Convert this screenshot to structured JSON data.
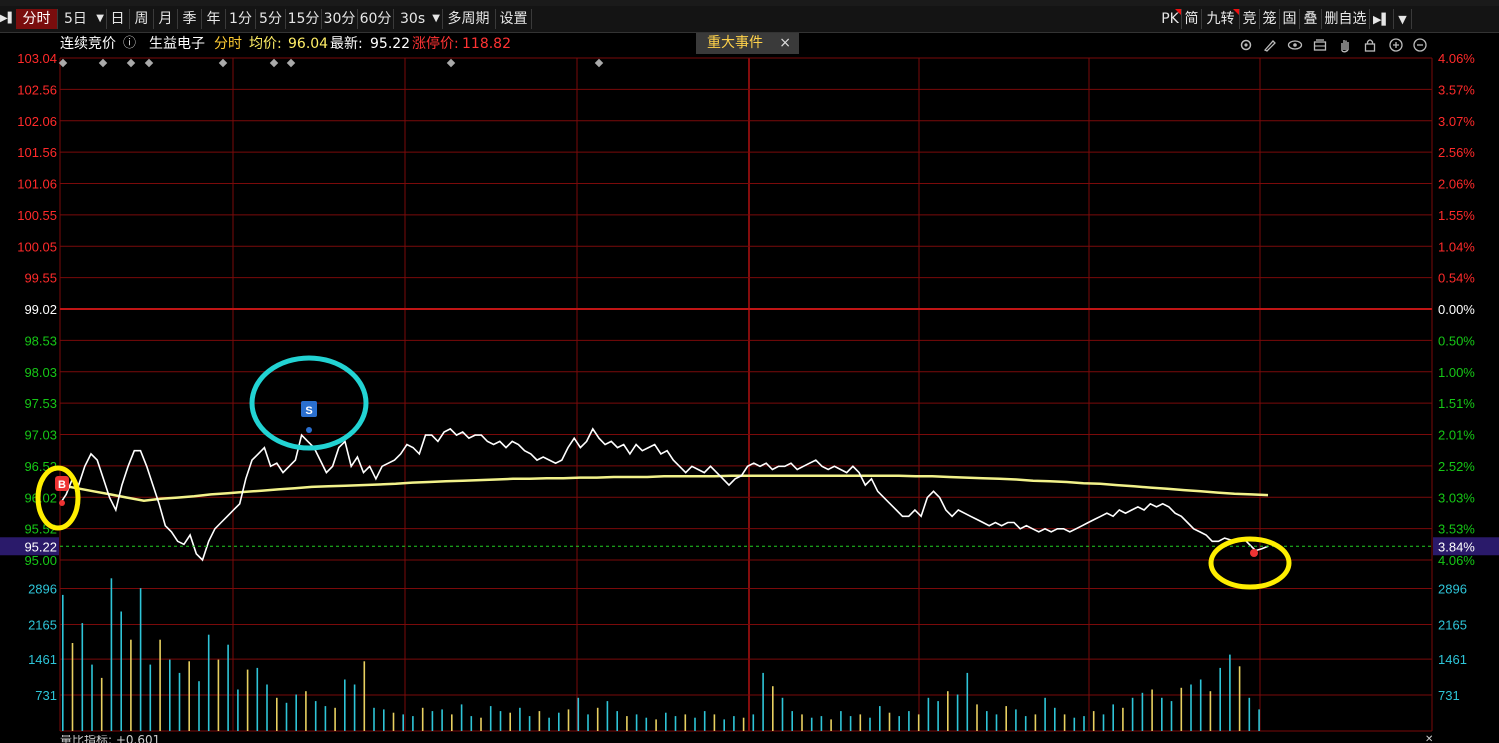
{
  "toolbar": {
    "play_glyph": "▶▌",
    "tabs": [
      {
        "label": "分时",
        "active": true
      },
      {
        "label": "5日",
        "dropdown": true
      },
      {
        "label": "日"
      },
      {
        "label": "周"
      },
      {
        "label": "月"
      },
      {
        "label": "季"
      },
      {
        "label": "年"
      },
      {
        "label": "1分"
      },
      {
        "label": "5分"
      },
      {
        "label": "15分"
      },
      {
        "label": "30分"
      },
      {
        "label": "60分"
      },
      {
        "label": "30s",
        "dropdown": true
      },
      {
        "label": "多周期"
      },
      {
        "label": "设置"
      }
    ],
    "right_buttons": [
      {
        "label": "PK",
        "flag": true
      },
      {
        "label": "简"
      },
      {
        "label": "九转",
        "flag": true
      },
      {
        "label": "竞"
      },
      {
        "label": "笼"
      },
      {
        "label": "固"
      },
      {
        "label": "叠"
      },
      {
        "label": "删自选"
      },
      {
        "label": "▶▌"
      },
      {
        "label": "▼"
      }
    ]
  },
  "infobar": {
    "mode_label": "连续竞价",
    "info_icon": "ⓘ",
    "stock_name": "生益电子",
    "chart_type": "分时",
    "avg_label": "均价:",
    "avg_value": "96.04",
    "latest_label": "最新:",
    "latest_value": "95.22",
    "limit_label": "涨停价:",
    "limit_value": "118.82"
  },
  "event_tab": {
    "label": "重大事件",
    "close": "×"
  },
  "tool_icons": [
    "gear-icon",
    "pen-icon",
    "eye-icon",
    "layers-icon",
    "hand-icon",
    "lock-icon",
    "zoom-in-icon",
    "zoom-out-icon"
  ],
  "markers": {
    "buy": "B",
    "sell": "S"
  },
  "colors": {
    "up": "#ff2a2a",
    "down": "#16c716",
    "grid": "#7a0a0a",
    "price_line": "#ffffff",
    "avg_line": "#f2f28a",
    "vol_up": "#e8d060",
    "vol_down": "#2ec5d8",
    "current": "#2a1a6a",
    "circle_cyan": "#22d3d3",
    "circle_yellow": "#ffee00"
  },
  "bottom_indicator": "量比指标: +0.601",
  "chart_data": {
    "type": "line",
    "prev_close": 99.02,
    "price_axis": {
      "labels": [
        "103.04",
        "102.56",
        "102.06",
        "101.56",
        "101.06",
        "100.55",
        "100.05",
        "99.55",
        "99.02",
        "98.53",
        "98.03",
        "97.53",
        "97.03",
        "96.52",
        "96.02",
        "95.52",
        "95.00"
      ],
      "current": "95.22",
      "ylim": [
        95.0,
        103.04
      ]
    },
    "pct_axis": {
      "labels": [
        "4.06%",
        "3.57%",
        "3.07%",
        "2.56%",
        "2.06%",
        "1.55%",
        "1.04%",
        "0.54%",
        "0.00%",
        "0.50%",
        "1.00%",
        "1.51%",
        "2.01%",
        "2.52%",
        "3.03%",
        "3.53%",
        "4.06%"
      ],
      "current": "3.84%"
    },
    "volume_axis": {
      "labels": [
        "2896",
        "2165",
        "1461",
        "731"
      ],
      "values": [
        2896,
        2165,
        1461,
        731
      ]
    },
    "series": [
      {
        "key": "price",
        "values": [
          95.9,
          96.05,
          96.3,
          96.2,
          96.5,
          96.7,
          96.6,
          96.3,
          96.0,
          95.8,
          96.2,
          96.5,
          96.75,
          96.75,
          96.5,
          96.2,
          95.9,
          95.55,
          95.45,
          95.3,
          95.25,
          95.4,
          95.1,
          95.0,
          95.3,
          95.5,
          95.6,
          95.7,
          95.8,
          95.9,
          96.3,
          96.6,
          96.7,
          96.8,
          96.5,
          96.55,
          96.4,
          96.5,
          96.6,
          97.0,
          96.9,
          96.8,
          96.6,
          96.4,
          96.5,
          96.8,
          96.9,
          96.5,
          96.65,
          96.4,
          96.5,
          96.3,
          96.5,
          96.55,
          96.6,
          96.7,
          96.85,
          96.8,
          96.7,
          97.0,
          97.0,
          96.9,
          97.05,
          97.1,
          97.0,
          97.05,
          96.95,
          97.0,
          97.0,
          96.9,
          96.85,
          96.9,
          96.8,
          96.9,
          96.85,
          96.75,
          96.7,
          96.6,
          96.65,
          96.6,
          96.55,
          96.6,
          96.8,
          96.95,
          96.8,
          96.9,
          97.1,
          96.95,
          96.85,
          96.9,
          96.8,
          96.85,
          96.7,
          96.85,
          96.75,
          96.8,
          96.85,
          96.7,
          96.75,
          96.6,
          96.5,
          96.4,
          96.5,
          96.45,
          96.4,
          96.5,
          96.4,
          96.3,
          96.2,
          96.3,
          96.35,
          96.5,
          96.55,
          96.5,
          96.55,
          96.45,
          96.5,
          96.5,
          96.55,
          96.45,
          96.5,
          96.55,
          96.6,
          96.5,
          96.45,
          96.5,
          96.45,
          96.4,
          96.5,
          96.4,
          96.2,
          96.3,
          96.1,
          96.0,
          95.9,
          95.8,
          95.7,
          95.7,
          95.8,
          95.7,
          96.0,
          96.1,
          96.0,
          95.8,
          95.7,
          95.8,
          95.75,
          95.7,
          95.65,
          95.6,
          95.55,
          95.6,
          95.55,
          95.6,
          95.6,
          95.5,
          95.55,
          95.5,
          95.45,
          95.5,
          95.45,
          95.5,
          95.5,
          95.45,
          95.5,
          95.55,
          95.6,
          95.65,
          95.7,
          95.75,
          95.7,
          95.8,
          95.75,
          95.8,
          95.85,
          95.8,
          95.9,
          95.85,
          95.9,
          95.85,
          95.75,
          95.7,
          95.6,
          95.5,
          95.45,
          95.4,
          95.3,
          95.3,
          95.35,
          95.32,
          95.3,
          95.35,
          95.25,
          95.15,
          95.18,
          95.22
        ],
        "avg": [
          96.2,
          96.15,
          96.1,
          96.05,
          96.0,
          95.95,
          95.98,
          96.0,
          96.02,
          96.05,
          96.07,
          96.09,
          96.11,
          96.13,
          96.15,
          96.17,
          96.18,
          96.19,
          96.2,
          96.21,
          96.22,
          96.24,
          96.25,
          96.26,
          96.27,
          96.28,
          96.29,
          96.3,
          96.3,
          96.31,
          96.31,
          96.32,
          96.32,
          96.33,
          96.33,
          96.33,
          96.34,
          96.34,
          96.34,
          96.34,
          96.35,
          96.35,
          96.35,
          96.35,
          96.35,
          96.35,
          96.35,
          96.35,
          96.35,
          96.35,
          96.35,
          96.34,
          96.34,
          96.33,
          96.32,
          96.31,
          96.3,
          96.29,
          96.27,
          96.26,
          96.25,
          96.23,
          96.22,
          96.2,
          96.18,
          96.16,
          96.14,
          96.12,
          96.1,
          96.08,
          96.06,
          96.05,
          96.04
        ]
      }
    ],
    "volume_bars_norm": [
      0.82,
      0.53,
      0.65,
      0.4,
      0.32,
      0.92,
      0.72,
      0.55,
      0.86,
      0.4,
      0.55,
      0.43,
      0.35,
      0.42,
      0.3,
      0.58,
      0.43,
      0.52,
      0.25,
      0.37,
      0.38,
      0.28,
      0.2,
      0.17,
      0.22,
      0.24,
      0.18,
      0.15,
      0.14,
      0.31,
      0.28,
      0.42,
      0.14,
      0.13,
      0.11,
      0.1,
      0.09,
      0.14,
      0.12,
      0.13,
      0.1,
      0.16,
      0.09,
      0.08,
      0.15,
      0.12,
      0.11,
      0.14,
      0.09,
      0.12,
      0.08,
      0.11,
      0.13,
      0.2,
      0.1,
      0.14,
      0.18,
      0.12,
      0.09,
      0.1,
      0.08,
      0.07,
      0.11,
      0.09,
      0.1,
      0.08,
      0.12,
      0.1,
      0.07,
      0.09,
      0.08,
      0.1,
      0.35,
      0.27,
      0.2,
      0.12,
      0.1,
      0.08,
      0.09,
      0.07,
      0.12,
      0.09,
      0.1,
      0.08,
      0.15,
      0.11,
      0.09,
      0.12,
      0.1,
      0.2,
      0.18,
      0.24,
      0.22,
      0.35,
      0.16,
      0.12,
      0.1,
      0.15,
      0.13,
      0.09,
      0.1,
      0.2,
      0.14,
      0.1,
      0.08,
      0.09,
      0.12,
      0.1,
      0.16,
      0.14,
      0.2,
      0.23,
      0.25,
      0.2,
      0.18,
      0.26,
      0.28,
      0.31,
      0.24,
      0.38,
      0.46,
      0.39,
      0.2,
      0.13
    ]
  }
}
